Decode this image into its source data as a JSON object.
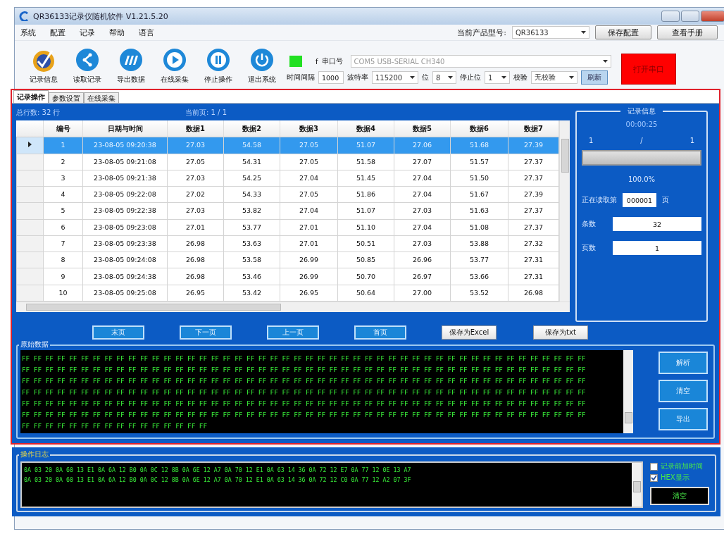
{
  "window": {
    "title": "QR36133记录仪随机软件  V1.21.5.20"
  },
  "menu": [
    "系统",
    "配置",
    "记录",
    "帮助",
    "语言"
  ],
  "product": {
    "label": "当前产品型号:",
    "value": "QR36133"
  },
  "top_buttons": [
    "保存配置",
    "查看手册"
  ],
  "toolbar": [
    {
      "label": "记录信息",
      "kind": "check"
    },
    {
      "label": "读取记录",
      "kind": "share"
    },
    {
      "label": "导出数据",
      "kind": "mp"
    },
    {
      "label": "在线采集",
      "kind": "play"
    },
    {
      "label": "停止操作",
      "kind": "pause"
    },
    {
      "label": "退出系统",
      "kind": "power"
    }
  ],
  "serial": {
    "status_mark": "f",
    "port_label": "串口号",
    "port": "COM5 USB-SERIAL CH340",
    "interval_label": "时间间隔",
    "interval": "1000",
    "baud_label": "波特率",
    "baud": "115200",
    "bits_label": "位",
    "bits": "8",
    "stop_label": "停止位",
    "stop": "1",
    "parity_label": "校验",
    "parity": "无校验",
    "refresh": "刷新",
    "open": "打开串口"
  },
  "tabs": [
    {
      "label": "记录操作",
      "selected": true
    },
    {
      "label": "参数设置",
      "selected": false
    },
    {
      "label": "在线采集",
      "selected": false
    }
  ],
  "summary": {
    "total": "总行数: 32 行",
    "page": "当前页: 1 / 1"
  },
  "table": {
    "columns": [
      "编号",
      "日期与时间",
      "数据1",
      "数据2",
      "数据3",
      "数据4",
      "数据5",
      "数据6",
      "数据7"
    ],
    "rows": [
      {
        "selected": true,
        "cells": [
          "1",
          "23-08-05 09:20:38",
          "27.03",
          "54.58",
          "27.05",
          "51.07",
          "27.06",
          "51.68",
          "27.39"
        ]
      },
      {
        "selected": false,
        "cells": [
          "2",
          "23-08-05 09:21:08",
          "27.05",
          "54.31",
          "27.05",
          "51.58",
          "27.07",
          "51.57",
          "27.37"
        ]
      },
      {
        "selected": false,
        "cells": [
          "3",
          "23-08-05 09:21:38",
          "27.03",
          "54.25",
          "27.04",
          "51.45",
          "27.04",
          "51.50",
          "27.37"
        ]
      },
      {
        "selected": false,
        "cells": [
          "4",
          "23-08-05 09:22:08",
          "27.02",
          "54.33",
          "27.05",
          "51.86",
          "27.04",
          "51.67",
          "27.39"
        ]
      },
      {
        "selected": false,
        "cells": [
          "5",
          "23-08-05 09:22:38",
          "27.03",
          "53.82",
          "27.04",
          "51.07",
          "27.03",
          "51.63",
          "27.37"
        ]
      },
      {
        "selected": false,
        "cells": [
          "6",
          "23-08-05 09:23:08",
          "27.01",
          "53.77",
          "27.01",
          "51.10",
          "27.04",
          "51.08",
          "27.37"
        ]
      },
      {
        "selected": false,
        "cells": [
          "7",
          "23-08-05 09:23:38",
          "26.98",
          "53.63",
          "27.01",
          "50.51",
          "27.03",
          "53.88",
          "27.32"
        ]
      },
      {
        "selected": false,
        "cells": [
          "8",
          "23-08-05 09:24:08",
          "26.98",
          "53.58",
          "26.99",
          "50.85",
          "26.96",
          "53.77",
          "27.31"
        ]
      },
      {
        "selected": false,
        "cells": [
          "9",
          "23-08-05 09:24:38",
          "26.98",
          "53.46",
          "26.99",
          "50.70",
          "26.97",
          "53.66",
          "27.31"
        ]
      },
      {
        "selected": false,
        "cells": [
          "10",
          "23-08-05 09:25:08",
          "26.95",
          "53.42",
          "26.95",
          "50.64",
          "27.00",
          "53.52",
          "26.98"
        ]
      }
    ]
  },
  "info": {
    "title": "记录信息",
    "elapsed": "00:00:25",
    "current": "1",
    "separator": "/",
    "total": "1",
    "level": 1,
    "percent": "100.0%",
    "reading_label": "正在读取第",
    "reading_page": "000001",
    "reading_unit": "页",
    "count_label": "条数",
    "count": "32",
    "pages_label": "页数",
    "pages": "1"
  },
  "page_buttons": [
    {
      "label": "末页",
      "kind": "nav"
    },
    {
      "label": "下一页",
      "kind": "nav"
    },
    {
      "label": "上一页",
      "kind": "nav"
    },
    {
      "label": "首页",
      "kind": "nav"
    },
    {
      "label": "保存为Excel",
      "kind": "save"
    },
    {
      "label": "保存为txt",
      "kind": "save"
    }
  ],
  "raw": {
    "title": "原始数据",
    "lines": [
      "FF FF FF FF FF FF FF FF FF FF FF FF FF FF FF FF FF FF FF FF FF FF FF FF FF FF FF FF FF FF FF FF FF FF FF FF FF FF FF FF FF FF FF FF FF FF FF FF",
      "FF FF FF FF FF FF FF FF FF FF FF FF FF FF FF FF FF FF FF FF FF FF FF FF FF FF FF FF FF FF FF FF FF FF FF FF FF FF FF FF FF FF FF FF FF FF FF FF",
      "FF FF FF FF FF FF FF FF FF FF FF FF FF FF FF FF FF FF FF FF FF FF FF FF FF FF FF FF FF FF FF FF FF FF FF FF FF FF FF FF FF FF FF FF FF FF FF FF",
      "FF FF FF FF FF FF FF FF FF FF FF FF FF FF FF FF FF FF FF FF FF FF FF FF FF FF FF FF FF FF FF FF FF FF FF FF FF FF FF FF FF FF FF FF FF FF FF FF",
      "FF FF FF FF FF FF FF FF FF FF FF FF FF FF FF FF FF FF FF FF FF FF FF FF FF FF FF FF FF FF FF FF FF FF FF FF FF FF FF FF FF FF FF FF FF FF FF FF",
      "FF FF FF FF FF FF FF FF FF FF FF FF FF FF FF FF FF FF FF FF FF FF FF FF FF FF FF FF FF FF FF FF FF FF FF FF FF FF FF FF FF FF FF FF FF FF FF FF",
      "FF FF FF FF FF FF FF FF FF FF FF FF FF FF FF FF"
    ],
    "buttons": [
      "解析",
      "清空",
      "导出"
    ]
  },
  "log": {
    "title": "操作日志",
    "lines": [
      "0A 03 20 0A 60 13 E1 0A 6A 12 B0 0A 0C 12 8B 0A 6E 12 A7 0A 70 12 E1 0A 63 14 36 0A 72 12 E7 0A 77 12 0E 13 A7",
      "0A 03 20 0A 60 13 E1 0A 6A 12 B0 0A 0C 12 8B 0A 6E 12 A7 0A 70 12 E1 0A 63 14 36 0A 72 12 C0 0A 77 12 A2 07 3F"
    ],
    "options": [
      {
        "label": "记录前加时间",
        "checked": false
      },
      {
        "label": "HEX显示",
        "checked": true
      }
    ],
    "clear": "清空"
  }
}
